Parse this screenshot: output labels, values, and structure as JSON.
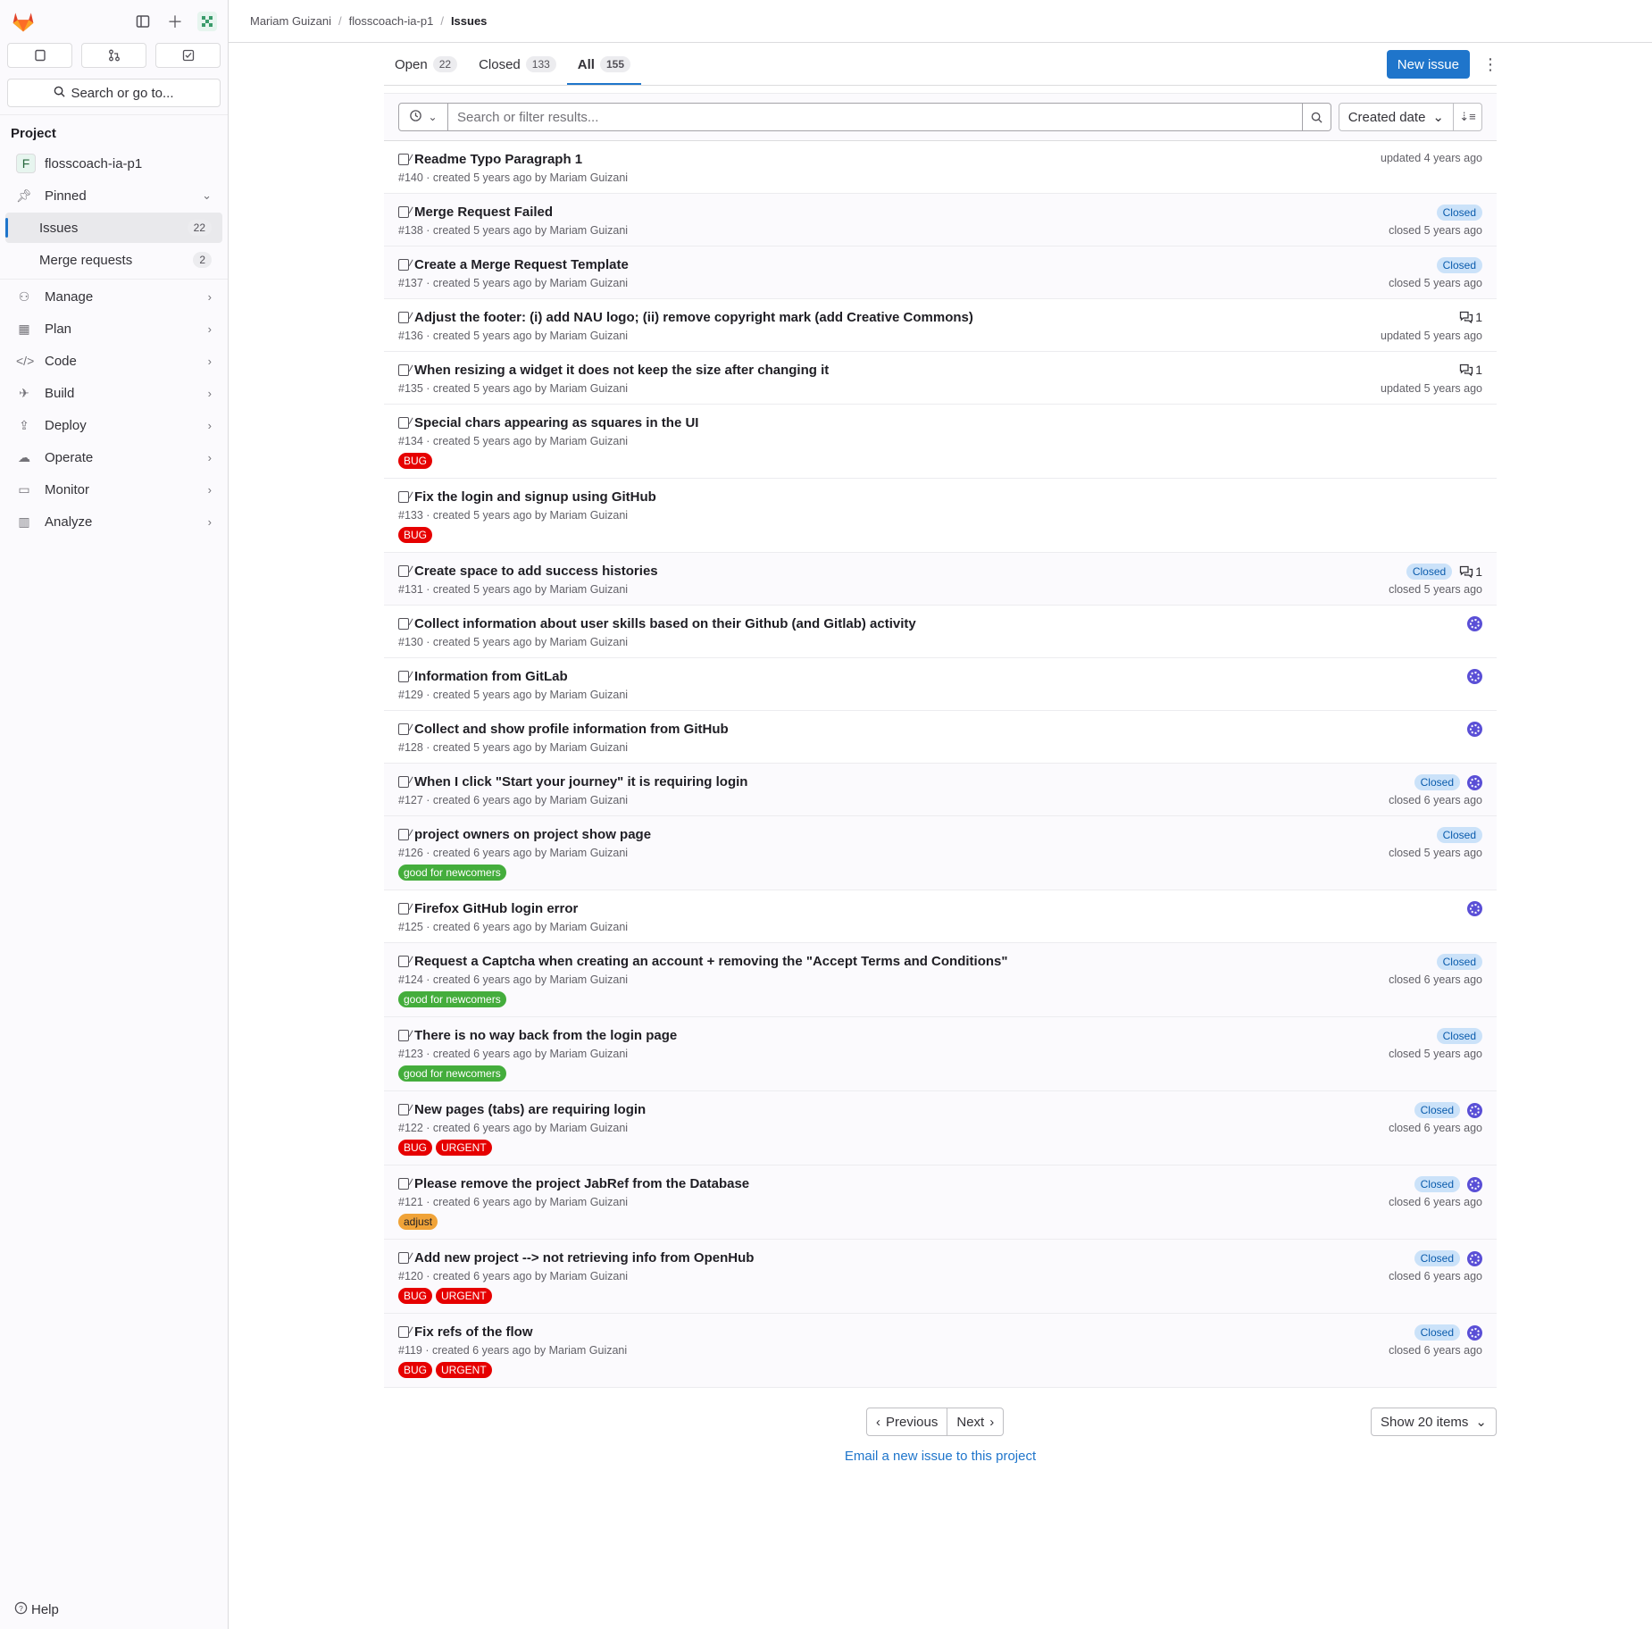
{
  "sidebar": {
    "search_label": "Search or go to...",
    "section_title": "Project",
    "project_initial": "F",
    "project_name": "flosscoach-ia-p1",
    "pinned_label": "Pinned",
    "pinned_items": [
      {
        "label": "Issues",
        "count": "22",
        "icon": "issues-icon"
      },
      {
        "label": "Merge requests",
        "count": "2",
        "icon": "merge-request-icon"
      }
    ],
    "nav_items": [
      {
        "label": "Manage",
        "icon": "users-icon"
      },
      {
        "label": "Plan",
        "icon": "calendar-icon"
      },
      {
        "label": "Code",
        "icon": "code-icon"
      },
      {
        "label": "Build",
        "icon": "rocket-icon"
      },
      {
        "label": "Deploy",
        "icon": "deploy-icon"
      },
      {
        "label": "Operate",
        "icon": "cloud-icon"
      },
      {
        "label": "Monitor",
        "icon": "monitor-icon"
      },
      {
        "label": "Analyze",
        "icon": "chart-icon"
      }
    ],
    "help_label": "Help"
  },
  "breadcrumb": {
    "user": "Mariam Guizani",
    "project": "flosscoach-ia-p1",
    "current": "Issues"
  },
  "tabs": [
    {
      "label": "Open",
      "count": "22"
    },
    {
      "label": "Closed",
      "count": "133"
    },
    {
      "label": "All",
      "count": "155",
      "active": true
    }
  ],
  "new_issue_label": "New issue",
  "filter": {
    "placeholder": "Search or filter results...",
    "sort_label": "Created date"
  },
  "issues": [
    {
      "title": "Readme Typo Paragraph 1",
      "meta": "#140 · created 5 years ago by Mariam Guizani",
      "state": "open",
      "status_text": "updated 4 years ago"
    },
    {
      "title": "Merge Request Failed",
      "meta": "#138 · created 5 years ago by Mariam Guizani",
      "state": "closed",
      "closed_label": "Closed",
      "status_text": "closed 5 years ago"
    },
    {
      "title": "Create a Merge Request Template",
      "meta": "#137 · created 5 years ago by Mariam Guizani",
      "state": "closed",
      "closed_label": "Closed",
      "status_text": "closed 5 years ago"
    },
    {
      "title": "Adjust the footer: (i) add NAU logo; (ii) remove copyright mark (add Creative Commons)",
      "meta": "#136 · created 5 years ago by Mariam Guizani",
      "state": "open",
      "comments": "1",
      "status_text": "updated 5 years ago"
    },
    {
      "title": "When resizing a widget it does not keep the size after changing it",
      "meta": "#135 · created 5 years ago by Mariam Guizani",
      "state": "open",
      "comments": "1",
      "status_text": "updated 5 years ago"
    },
    {
      "title": "Special chars appearing as squares in the UI",
      "meta": "#134 · created 5 years ago by Mariam Guizani",
      "state": "open",
      "labels": [
        {
          "text": "BUG",
          "color": "#e60000"
        }
      ]
    },
    {
      "title": "Fix the login and signup using GitHub",
      "meta": "#133 · created 5 years ago by Mariam Guizani",
      "state": "open",
      "labels": [
        {
          "text": "BUG",
          "color": "#e60000"
        }
      ]
    },
    {
      "title": "Create space to add success histories",
      "meta": "#131 · created 5 years ago by Mariam Guizani",
      "state": "closed",
      "closed_label": "Closed",
      "comments": "1",
      "status_text": "closed 5 years ago"
    },
    {
      "title": "Collect information about user skills based on their Github (and Gitlab) activity",
      "meta": "#130 · created 5 years ago by Mariam Guizani",
      "state": "open",
      "assignee": true
    },
    {
      "title": "Information from GitLab",
      "meta": "#129 · created 5 years ago by Mariam Guizani",
      "state": "open",
      "assignee": true
    },
    {
      "title": "Collect and show profile information from GitHub",
      "meta": "#128 · created 5 years ago by Mariam Guizani",
      "state": "open",
      "assignee": true
    },
    {
      "title": "When I click \"Start your journey\" it is requiring login",
      "meta": "#127 · created 6 years ago by Mariam Guizani",
      "state": "closed",
      "closed_label": "Closed",
      "assignee": true,
      "status_text": "closed 6 years ago"
    },
    {
      "title": "project owners on project show page",
      "meta": "#126 · created 6 years ago by Mariam Guizani",
      "state": "closed",
      "closed_label": "Closed",
      "status_text": "closed 5 years ago",
      "labels": [
        {
          "text": "good for newcomers",
          "color": "#44ad3c"
        }
      ]
    },
    {
      "title": "Firefox GitHub login error",
      "meta": "#125 · created 6 years ago by Mariam Guizani",
      "state": "open",
      "assignee": true
    },
    {
      "title": "Request a Captcha when creating an account + removing the \"Accept Terms and Conditions\"",
      "meta": "#124 · created 6 years ago by Mariam Guizani",
      "state": "closed",
      "closed_label": "Closed",
      "status_text": "closed 6 years ago",
      "labels": [
        {
          "text": "good for newcomers",
          "color": "#44ad3c"
        }
      ]
    },
    {
      "title": "There is no way back from the login page",
      "meta": "#123 · created 6 years ago by Mariam Guizani",
      "state": "closed",
      "closed_label": "Closed",
      "status_text": "closed 5 years ago",
      "labels": [
        {
          "text": "good for newcomers",
          "color": "#44ad3c"
        }
      ]
    },
    {
      "title": "New pages (tabs) are requiring login",
      "meta": "#122 · created 6 years ago by Mariam Guizani",
      "state": "closed",
      "closed_label": "Closed",
      "assignee": true,
      "status_text": "closed 6 years ago",
      "labels": [
        {
          "text": "BUG",
          "color": "#e60000"
        },
        {
          "text": "URGENT",
          "color": "#e60000"
        }
      ]
    },
    {
      "title": "Please remove the project JabRef from the Database",
      "meta": "#121 · created 6 years ago by Mariam Guizani",
      "state": "closed",
      "closed_label": "Closed",
      "assignee": true,
      "status_text": "closed 6 years ago",
      "labels": [
        {
          "text": "adjust",
          "color": "#f0a338",
          "dark": true
        }
      ]
    },
    {
      "title": "Add new project --> not retrieving info from OpenHub",
      "meta": "#120 · created 6 years ago by Mariam Guizani",
      "state": "closed",
      "closed_label": "Closed",
      "assignee": true,
      "status_text": "closed 6 years ago",
      "labels": [
        {
          "text": "BUG",
          "color": "#e60000"
        },
        {
          "text": "URGENT",
          "color": "#e60000"
        }
      ]
    },
    {
      "title": "Fix refs of the flow",
      "meta": "#119 · created 6 years ago by Mariam Guizani",
      "state": "closed",
      "closed_label": "Closed",
      "assignee": true,
      "status_text": "closed 6 years ago",
      "labels": [
        {
          "text": "BUG",
          "color": "#e60000"
        },
        {
          "text": "URGENT",
          "color": "#e60000"
        }
      ]
    }
  ],
  "pagination": {
    "previous_label": "Previous",
    "next_label": "Next",
    "per_page_label": "Show 20 items"
  },
  "email_link": "Email a new issue to this project"
}
